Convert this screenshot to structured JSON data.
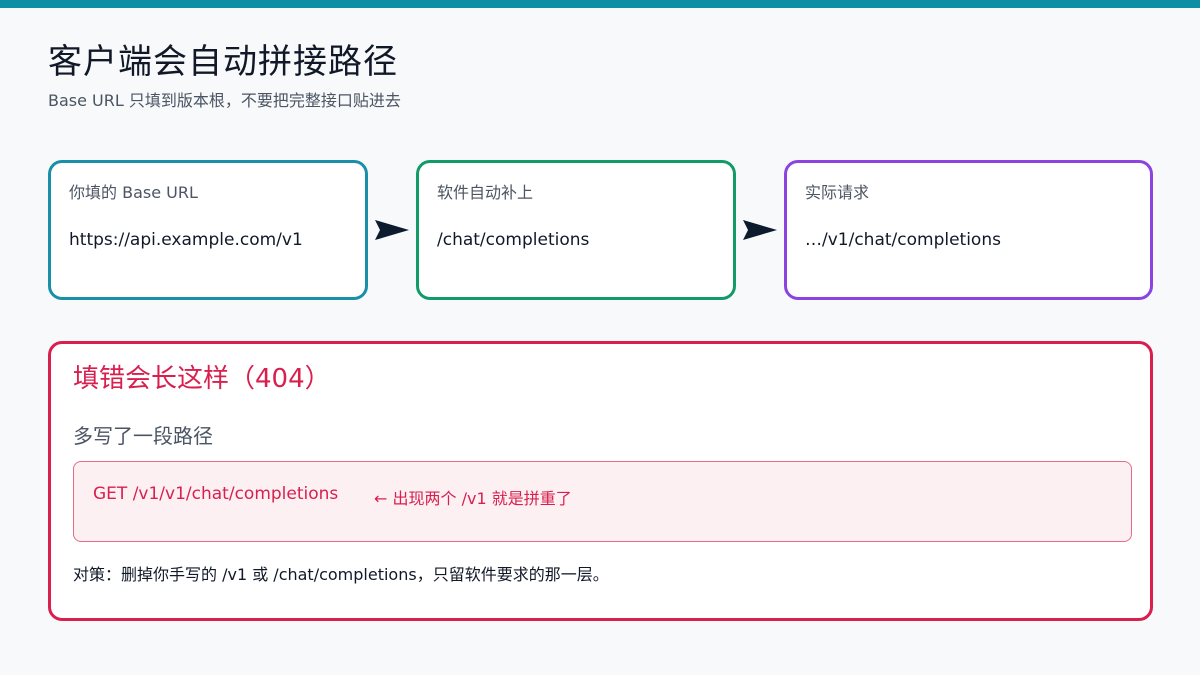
{
  "header": {
    "title": "客户端会自动拼接路径",
    "subtitle": "Base URL 只填到版本根，不要把完整接口贴进去"
  },
  "steps": [
    {
      "label": "你填的 Base URL",
      "value": "https://api.example.com/v1",
      "color": "#1a8fa8"
    },
    {
      "label": "软件自动补上",
      "value": "/chat/completions",
      "color": "#129a68"
    },
    {
      "label": "实际请求",
      "value": "…/v1/chat/completions",
      "color": "#8b44e0"
    }
  ],
  "arrow_icon": "right-arrow-icon",
  "error": {
    "title": "填错会长这样（404）",
    "description": "多写了一段路径",
    "code": "GET /v1/v1/chat/completions",
    "note": "← 出现两个 /v1 就是拼重了",
    "fix": "对策：删掉你手写的 /v1 或 /chat/completions，只留软件要求的那一层。",
    "color": "#d81f4e"
  },
  "colors": {
    "top_bar": "#0f8fa6",
    "background": "#f7f9fb",
    "code_background": "#fdf0f2"
  }
}
